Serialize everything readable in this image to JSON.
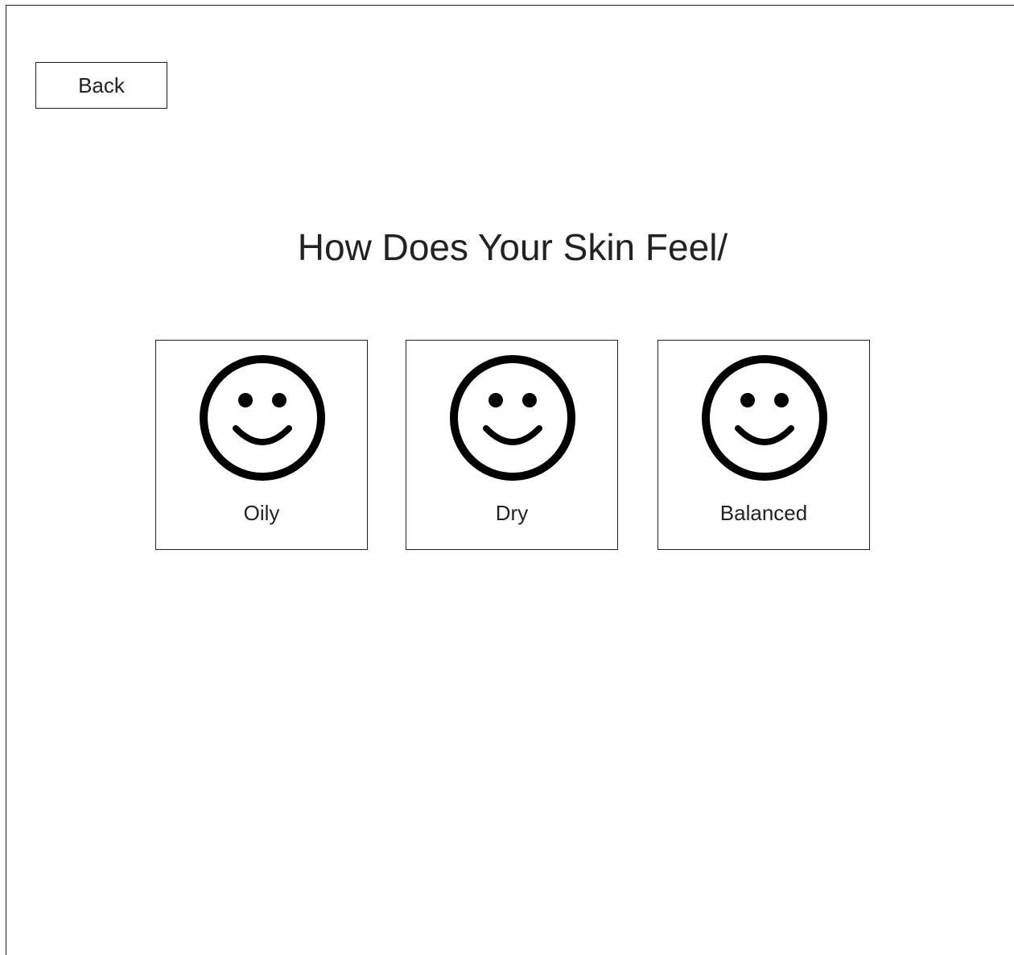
{
  "header": {
    "back_label": "Back"
  },
  "main": {
    "title": "How Does Your Skin Feel/",
    "options": [
      {
        "label": "Oily",
        "icon": "smiley-face-icon"
      },
      {
        "label": "Dry",
        "icon": "smiley-face-icon"
      },
      {
        "label": "Balanced",
        "icon": "smiley-face-icon"
      }
    ]
  }
}
